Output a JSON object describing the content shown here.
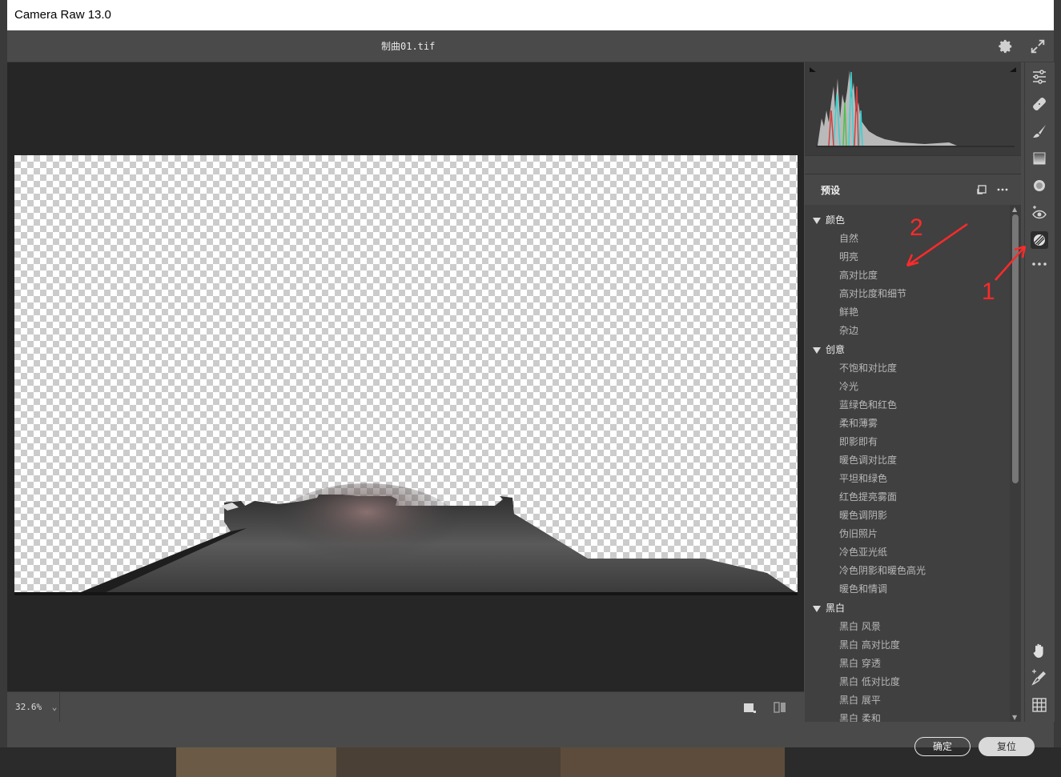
{
  "window": {
    "title": "Camera Raw 13.0"
  },
  "topbar": {
    "filename": "制曲01.tif"
  },
  "bottombar": {
    "zoom": "32.6%"
  },
  "presets": {
    "title": "预设",
    "groups": [
      {
        "label": "颜色",
        "items": [
          "自然",
          "明亮",
          "高对比度",
          "高对比度和细节",
          "鲜艳",
          "杂边"
        ]
      },
      {
        "label": "创意",
        "items": [
          "不饱和对比度",
          "冷光",
          "蓝绿色和红色",
          "柔和薄雾",
          "即影即有",
          "暖色调对比度",
          "平坦和绿色",
          "红色提亮雾面",
          "暖色调阴影",
          "伪旧照片",
          "冷色亚光纸",
          "冷色阴影和暖色高光",
          "暖色和情调"
        ]
      },
      {
        "label": "黑白",
        "items": [
          "黑白 风景",
          "黑白 高对比度",
          "黑白 穿透",
          "黑白 低对比度",
          "黑白 展平",
          "黑白 柔和"
        ]
      }
    ]
  },
  "buttons": {
    "ok": "确定",
    "reset": "复位"
  },
  "annotations": {
    "one": "1",
    "two": "2"
  },
  "colors": {
    "accent": "#ff2a2a",
    "panel": "#4a4a4a",
    "canvas": "#262626"
  },
  "tools": [
    "edit-sliders-icon",
    "healing-brush-icon",
    "adjustment-brush-icon",
    "graduated-filter-icon",
    "radial-filter-icon",
    "red-eye-icon",
    "presets-icon",
    "more-icon",
    "hand-icon",
    "color-sampler-icon",
    "grid-icon"
  ]
}
